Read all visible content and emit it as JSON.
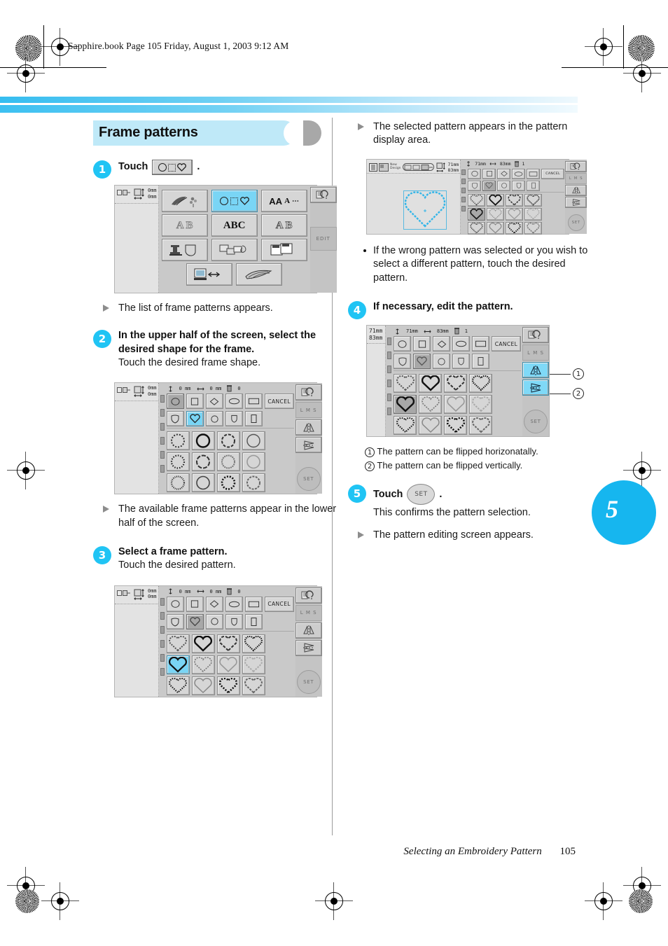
{
  "page": {
    "book_header": "Sapphire.book  Page 105  Friday, August 1, 2003  9:12 AM",
    "footer_title": "Selecting an Embroidery Pattern",
    "footer_page": "105",
    "chapter_tab": "5",
    "accent_cyan": "#20c4f4",
    "title_band": "#bfe9f8"
  },
  "section": {
    "title": "Frame patterns"
  },
  "steps": {
    "s1": {
      "number": "1",
      "touch_label": "Touch",
      "period": ".",
      "result": "The list of frame patterns appears."
    },
    "s2": {
      "number": "2",
      "title": "In the upper half of the screen, select the desired shape for the frame.",
      "sub": "Touch the desired frame shape.",
      "result": "The available frame patterns appear in the lower half of the screen."
    },
    "s3": {
      "number": "3",
      "title": "Select a frame pattern.",
      "sub": "Touch the desired pattern."
    },
    "s3b": {
      "result": "The selected pattern appears in the pattern display area.",
      "note": "If the wrong pattern was selected or you wish to select a different pattern, touch the desired pattern."
    },
    "s4": {
      "number": "4",
      "title": "If necessary, edit the pattern.",
      "callout1": "1",
      "callout2": "2",
      "note1": "The pattern can be flipped horizonatally.",
      "note2": "The pattern can be flipped vertically."
    },
    "s5": {
      "number": "5",
      "touch_label": "Touch",
      "set_label": "SET",
      "period": ".",
      "sub": "This confirms the pattern selection.",
      "result": "The pattern editing screen appears."
    }
  },
  "lcd_common": {
    "cancel": "CANCEL",
    "set": "SET",
    "size": "L M S",
    "zero_mm": "0mm",
    "dim_h": "0 mm",
    "dim_w": "0 mm",
    "count": "0",
    "sel_dim_h": "71mm",
    "sel_dim_w": "83mm",
    "sel_count": "1",
    "new_pattern": "New\nDesign"
  },
  "screen1": {
    "name": "pattern-category-screen",
    "edit_label": "EDIT",
    "categories": [
      {
        "id": "embroidery-patterns",
        "icon": "bird-flower-icon",
        "selected": false
      },
      {
        "id": "frame-patterns",
        "icon": "circle-square-heart-icon",
        "selected": true
      },
      {
        "id": "alphabet-characters",
        "icon": "AA-font-icon",
        "selected": false
      },
      {
        "id": "monogram-ab",
        "icon": "monogram-AB-icon",
        "selected": false
      },
      {
        "id": "script-abc",
        "icon": "script-ABC-icon",
        "selected": false
      },
      {
        "id": "outline-ab",
        "icon": "outline-AB-icon",
        "selected": false
      },
      {
        "id": "quilting-patterns",
        "icon": "machine-pocket-icon",
        "selected": false
      },
      {
        "id": "card-patterns",
        "icon": "memory-card-icon",
        "selected": false
      },
      {
        "id": "saved-patterns",
        "icon": "floppy-disk-icon",
        "selected": false
      },
      {
        "id": "computer-transfer",
        "icon": "pc-usb-icon",
        "selected": false
      },
      {
        "id": "ribbon-patterns",
        "icon": "ribbon-icon",
        "selected": false
      }
    ]
  },
  "screen2": {
    "name": "frame-shape-selection-screen",
    "shapes_row1": [
      "circle",
      "square",
      "diamond",
      "oval",
      "rectangle"
    ],
    "shapes_row2": [
      "shield",
      "heart",
      "small-circle",
      "crest",
      "vertical-bar"
    ],
    "shape_selected": "heart",
    "shape_row1_selected": "circle",
    "patterns_kind": "circle",
    "pattern_rows": 3,
    "pattern_cols": 4
  },
  "screen3": {
    "name": "frame-pattern-selection-screen",
    "patterns_kind": "heart",
    "selected_index": 4,
    "pattern_rows": 3,
    "pattern_cols": 4
  },
  "screen4": {
    "name": "pattern-display-screen",
    "preview": "heart-outline-cyan",
    "selected_index": 4
  },
  "screen5": {
    "name": "pattern-edit-screen",
    "selected_index": 4,
    "flip_h_active": true,
    "flip_v_active": true
  }
}
